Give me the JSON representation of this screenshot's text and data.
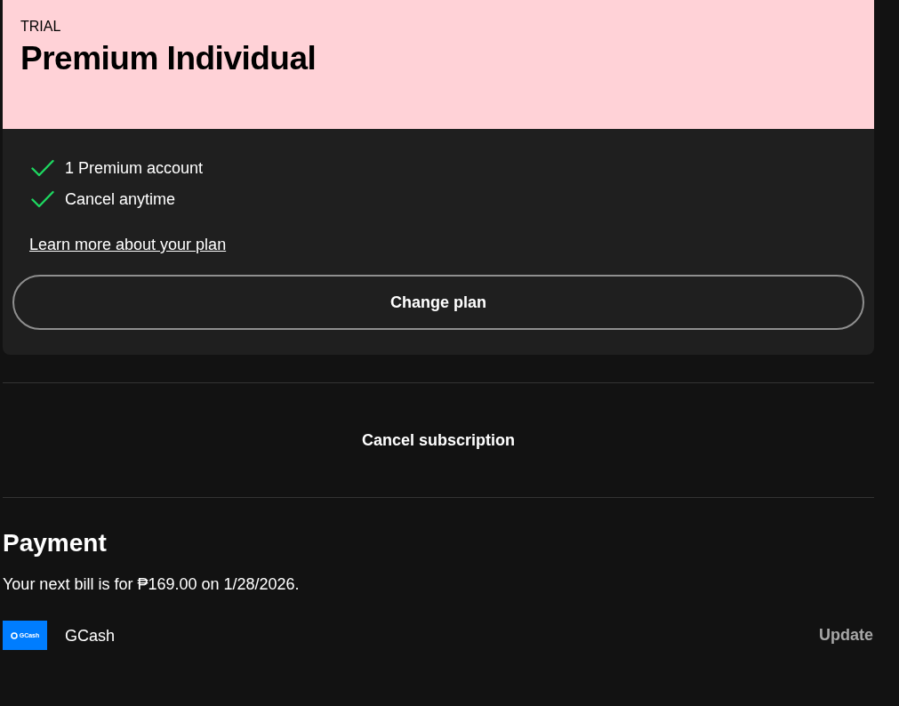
{
  "plan": {
    "badge": "TRIAL",
    "title": "Premium Individual",
    "features": [
      "1 Premium account",
      "Cancel anytime"
    ],
    "link": "Learn more about your plan",
    "button": "Change plan"
  },
  "cancel": {
    "label": "Cancel subscription"
  },
  "payment": {
    "title": "Payment",
    "bill": "Your next bill is for ₱169.00 on 1/28/2026.",
    "method": {
      "logo_text": "GCash",
      "name": "GCash",
      "action": "Update"
    }
  }
}
